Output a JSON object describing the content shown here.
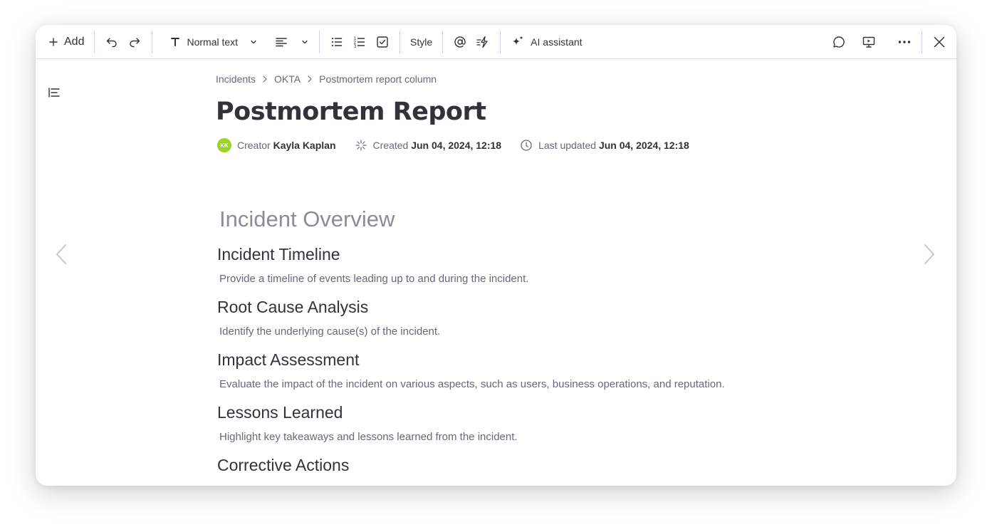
{
  "toolbar": {
    "add_label": "Add",
    "text_style_label": "Normal text",
    "style_label": "Style",
    "ai_label": "AI assistant"
  },
  "breadcrumb": [
    "Incidents",
    "OKTA",
    "Postmortem report column"
  ],
  "page": {
    "title": "Postmortem Report"
  },
  "meta": {
    "avatar_initials": "KK",
    "creator_label": "Creator",
    "creator_name": "Kayla Kaplan",
    "created_label": "Created",
    "created_value": "Jun 04, 2024, 12:18",
    "updated_label": "Last updated",
    "updated_value": "Jun 04, 2024, 12:18"
  },
  "doc": {
    "heading": "Incident Overview",
    "sections": [
      {
        "title": "Incident Timeline",
        "text": "Provide a timeline of events leading up to and during the incident."
      },
      {
        "title": "Root Cause Analysis",
        "text": "Identify the underlying cause(s) of the incident."
      },
      {
        "title": "Impact Assessment",
        "text": "Evaluate the impact of the incident on various aspects, such as users, business operations, and reputation."
      },
      {
        "title": "Lessons Learned",
        "text": "Highlight key takeaways and lessons learned from the incident."
      },
      {
        "title": "Corrective Actions",
        "text": ""
      }
    ]
  },
  "icons": {
    "add": "plus-icon",
    "undo": "undo-icon",
    "redo": "redo-icon",
    "text": "text-type-icon",
    "align": "align-left-icon",
    "bullets": "bullet-list-icon",
    "numbers": "numbered-list-icon",
    "checklist": "checklist-icon",
    "mention": "at-icon",
    "automation": "lightning-icon",
    "ai": "sparkle-icon",
    "comment": "comment-icon",
    "present": "presentation-icon",
    "more": "more-icon",
    "close": "close-icon",
    "outline": "outline-icon"
  },
  "colors": {
    "avatar": "#9cd326",
    "text_primary": "#323338",
    "text_secondary": "#676879"
  }
}
